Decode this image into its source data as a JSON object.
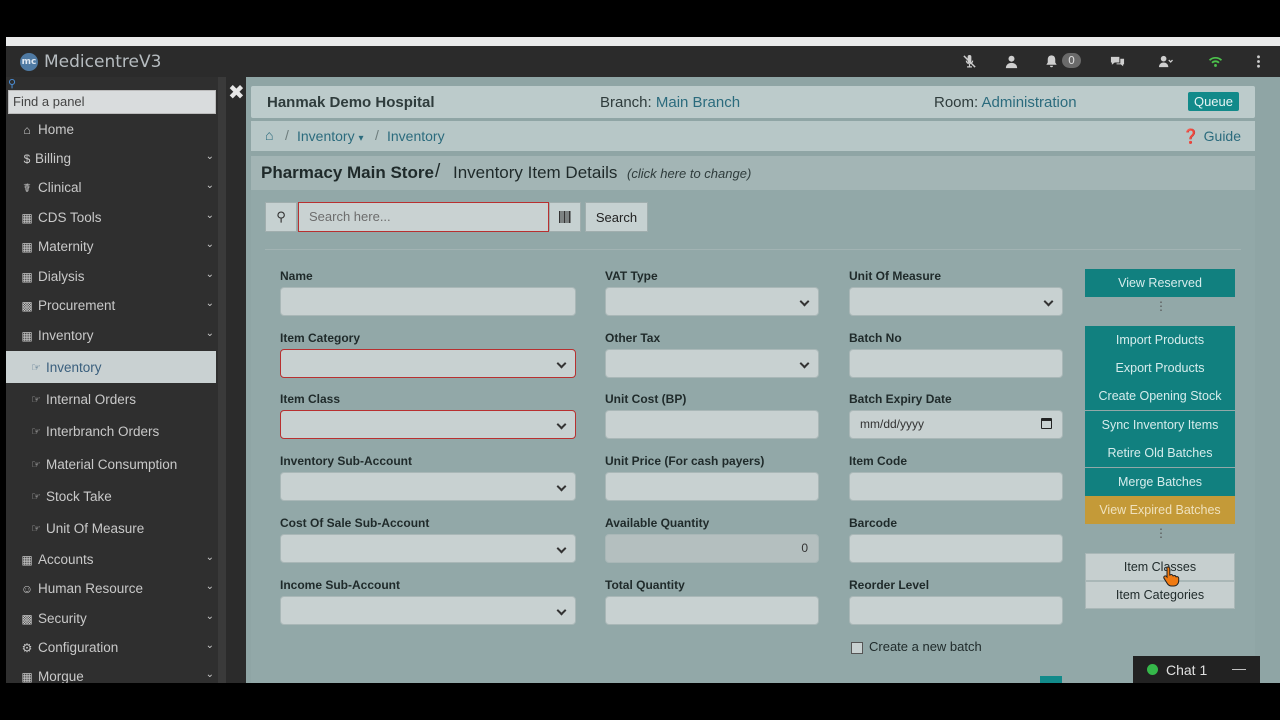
{
  "app": {
    "title": "MedicentreV3",
    "logo_text": "mc"
  },
  "navbar": {
    "notification_count": "0"
  },
  "sidebar": {
    "search_placeholder": "Find a panel",
    "items": [
      {
        "label": "Home",
        "icon": "home-icon"
      },
      {
        "label": "Billing",
        "icon": "dollar-icon"
      },
      {
        "label": "Clinical",
        "icon": "stethoscope-icon"
      },
      {
        "label": "CDS Tools",
        "icon": "book-icon"
      },
      {
        "label": "Maternity",
        "icon": "book-icon"
      },
      {
        "label": "Dialysis",
        "icon": "book-icon"
      },
      {
        "label": "Procurement",
        "icon": "lock-icon"
      },
      {
        "label": "Inventory",
        "icon": "book-icon"
      }
    ],
    "sub_items": [
      {
        "label": "Inventory"
      },
      {
        "label": "Internal Orders"
      },
      {
        "label": "Interbranch Orders"
      },
      {
        "label": "Material Consumption"
      },
      {
        "label": "Stock Take"
      },
      {
        "label": "Unit Of Measure"
      }
    ],
    "items_after": [
      {
        "label": "Accounts",
        "icon": "book-icon"
      },
      {
        "label": "Human Resource",
        "icon": "users-icon"
      },
      {
        "label": "Security",
        "icon": "lock-icon"
      },
      {
        "label": "Configuration",
        "icon": "cogs-icon"
      },
      {
        "label": "Morgue",
        "icon": "building-icon"
      }
    ]
  },
  "header": {
    "hospital": "Hanmak Demo Hospital",
    "branch_label": "Branch: ",
    "branch_value": "Main Branch",
    "room_label": "Room: ",
    "room_value": "Administration",
    "queue_button": "Queue"
  },
  "breadcrumb": {
    "item1": "Inventory",
    "item2": "Inventory",
    "guide": "Guide"
  },
  "panel": {
    "store": "Pharmacy Main Store",
    "separator": "/",
    "title": "Inventory Item Details",
    "hint": "(click here to change)"
  },
  "search": {
    "placeholder": "Search here...",
    "button": "Search"
  },
  "form": {
    "name": "Name",
    "vat_type": "VAT Type",
    "unit_of_measure": "Unit Of Measure",
    "item_category": "Item Category",
    "other_tax": "Other Tax",
    "batch_no": "Batch No",
    "item_class": "Item Class",
    "unit_cost": "Unit Cost (BP)",
    "batch_expiry": "Batch Expiry Date",
    "batch_expiry_value": "mm/dd/yyyy",
    "inventory_sub_account": "Inventory Sub-Account",
    "unit_price": "Unit Price (For cash payers)",
    "item_code": "Item Code",
    "cost_of_sale_sub_account": "Cost Of Sale Sub-Account",
    "available_quantity": "Available Quantity",
    "available_quantity_value": "0",
    "barcode": "Barcode",
    "income_sub_account": "Income Sub-Account",
    "total_quantity": "Total Quantity",
    "reorder_level": "Reorder Level",
    "create_batch": "Create a new batch"
  },
  "actions": {
    "view_reserved": "View Reserved",
    "import_products": "Import Products",
    "export_products": "Export Products",
    "create_opening_stock": "Create Opening Stock",
    "sync_inventory": "Sync Inventory Items",
    "retire_batches": "Retire Old Batches",
    "merge_batches": "Merge Batches",
    "view_expired": "View Expired Batches",
    "item_classes": "Item Classes",
    "item_categories": "Item Categories"
  },
  "chat": {
    "label": "Chat 1",
    "minimize": "—"
  },
  "colors": {
    "accent": "#11807f",
    "warning": "#c49a38",
    "required_border": "#b83030"
  }
}
